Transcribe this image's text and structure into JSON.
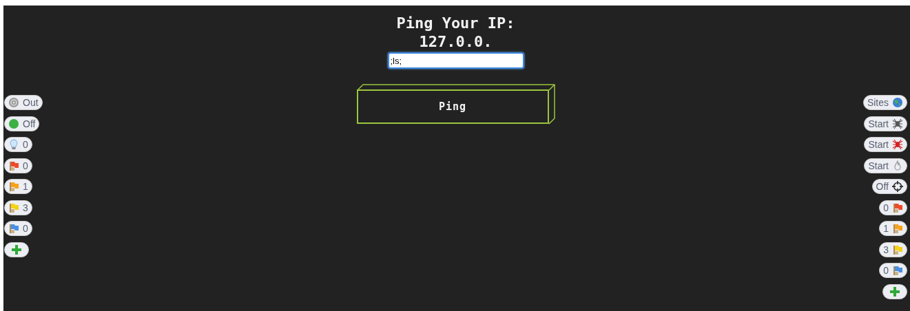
{
  "title": {
    "line_1": "Ping Your IP:",
    "line_2": "127.0.0."
  },
  "ip_field": {
    "value": ";ls;"
  },
  "ping_button": {
    "label": "Ping"
  },
  "left_badges": [
    {
      "kind": "target",
      "label": "Out"
    },
    {
      "kind": "dot",
      "label": "Off",
      "color": "#3cb043"
    },
    {
      "kind": "bulb",
      "label": "0"
    },
    {
      "kind": "flag",
      "label": "0",
      "color": "#ee4b2b"
    },
    {
      "kind": "flag",
      "label": "1",
      "color": "#f7a21b"
    },
    {
      "kind": "flag",
      "label": "3",
      "color": "#f2d31a"
    },
    {
      "kind": "flag",
      "label": "0",
      "color": "#4a90e2"
    },
    {
      "kind": "add"
    }
  ],
  "right_badges": [
    {
      "kind": "globe",
      "label": "Sites"
    },
    {
      "kind": "spider",
      "label": "Start",
      "color": "#555555"
    },
    {
      "kind": "spider",
      "label": "Start",
      "color": "#d42020"
    },
    {
      "kind": "flame",
      "label": "Start"
    },
    {
      "kind": "crosshair",
      "label": "Off"
    },
    {
      "kind": "flag",
      "label": "0",
      "color": "#ee4b2b"
    },
    {
      "kind": "flag",
      "label": "1",
      "color": "#f7a21b"
    },
    {
      "kind": "flag",
      "label": "3",
      "color": "#f2d31a"
    },
    {
      "kind": "flag",
      "label": "0",
      "color": "#4a90e2"
    },
    {
      "kind": "add"
    }
  ]
}
